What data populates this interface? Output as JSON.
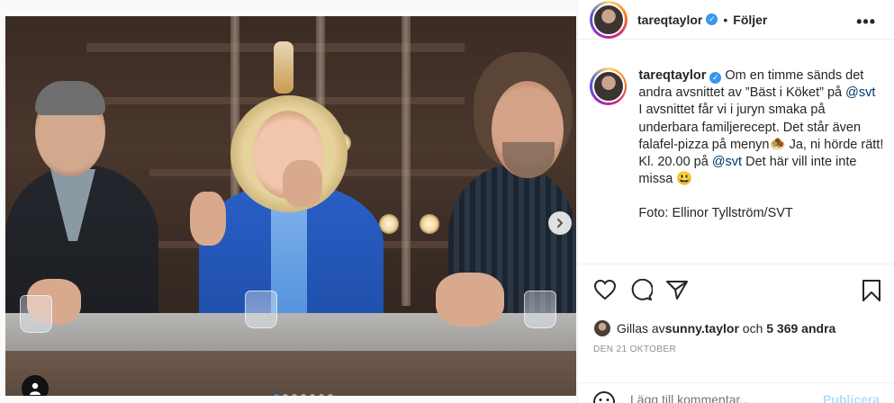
{
  "post": {
    "username": "tareqtaylor",
    "separator": "•",
    "follow_label": "Följer",
    "more_icon": "more-horizontal-icon",
    "caption": {
      "username": "tareqtaylor",
      "p1_a": "Om en timme sänds det andra avsnittet av ”Bäst i Köket” på ",
      "p1_mention": "@svt",
      "p2_a": "I avsnittet får vi i juryn smaka på underbara familjerecept. Det står även falafel-pizza på menyn",
      "p2_emoji": "🧆",
      "p2_b": " Ja, ni hörde rätt! Kl. 20.00 på ",
      "p2_mention": "@svt",
      "p2_c": " Det här vill inte inte missa ",
      "p2_emoji2": "😃",
      "photo_credit": "Foto: Ellinor Tyllström/SVT"
    },
    "likes": {
      "prefix": "Gillas av ",
      "user": "sunny.taylor",
      "middle": " och ",
      "count": "5 369 andra"
    },
    "date": "DEN 21 OKTOBER",
    "comment": {
      "placeholder": "Lägg till kommentar...",
      "publish_label": "Publicera"
    }
  },
  "carousel": {
    "total": 7,
    "active_index": 0
  },
  "colors": {
    "accent": "#3897f0",
    "text": "#262626",
    "muted": "#8e8e8e",
    "publish_disabled": "#b2dffc"
  }
}
